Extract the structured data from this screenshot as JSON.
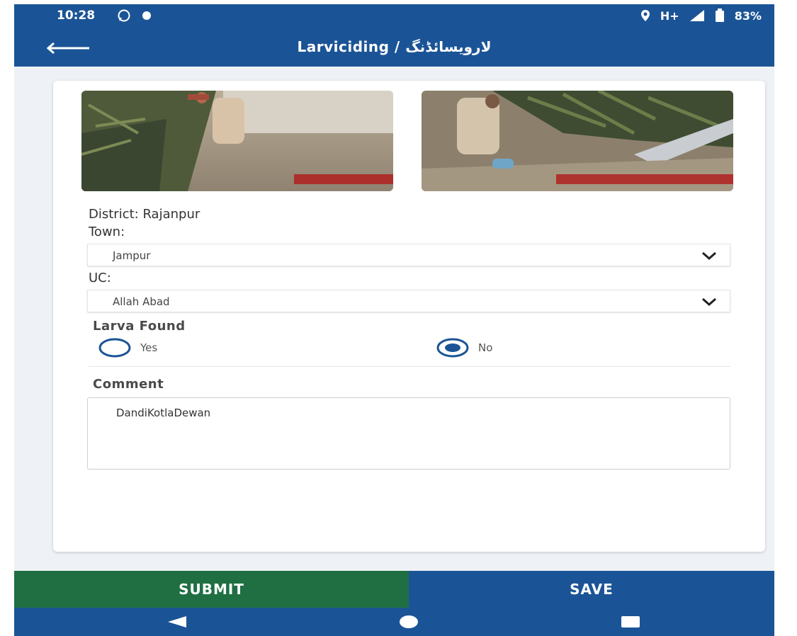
{
  "status_bar": {
    "time": "10:28",
    "network": "H+",
    "battery": "83%"
  },
  "app_bar": {
    "title": "Larviciding / لارویسائڈنگ"
  },
  "form": {
    "district_text": "District: Rajanpur",
    "town_label": "Town:",
    "town_value": "Jampur",
    "uc_label": "UC:",
    "uc_value": "Allah Abad",
    "larva_found_label": "Larva Found",
    "larva_options": [
      {
        "label": "Yes",
        "selected": false
      },
      {
        "label": "No",
        "selected": true
      }
    ],
    "comment_label": "Comment",
    "comment_value": "DandiKotlaDewan"
  },
  "actions": {
    "submit_label": "SUBMIT",
    "save_label": "SAVE"
  },
  "colors": {
    "primary": "#1b5496",
    "submit": "#1f6f43",
    "background": "#eef1f5"
  }
}
